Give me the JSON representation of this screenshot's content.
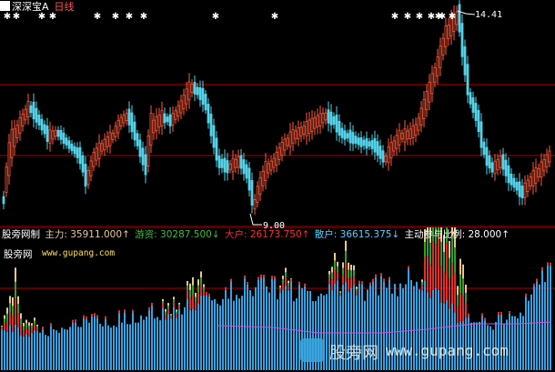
{
  "header": {
    "stock_name": "深深宝A",
    "period": "日线"
  },
  "main_chart": {
    "high_label": "14.41",
    "low_label": "9.00"
  },
  "indicator": {
    "title": "股旁网制",
    "zhuli": "主力: 35911.000↑",
    "youzi": "游资: 30287.500↓",
    "dahu": "大户: 26173.750↑",
    "sanhu": "散户: 36615.375↓",
    "ratio": "主动参与比例: 28.000↑",
    "site_name": "股旁网",
    "site_url": "www.gupang.com"
  },
  "watermark": {
    "label": "股旁网",
    "url": "www.gupang.com"
  },
  "colors": {
    "up": "#ff5a3c",
    "down": "#54d2e8",
    "zhuli": "#e8c8a0",
    "youzi": "#3fbf3f",
    "dahu": "#ff3030",
    "sanhu": "#5bd0ff",
    "ratio": "#ffffff",
    "hist_blue": "#3aa0e0",
    "hist_red": "#e03030",
    "hist_green": "#30a030",
    "hist_tan": "#e8c890",
    "axis": "#b00000"
  }
}
